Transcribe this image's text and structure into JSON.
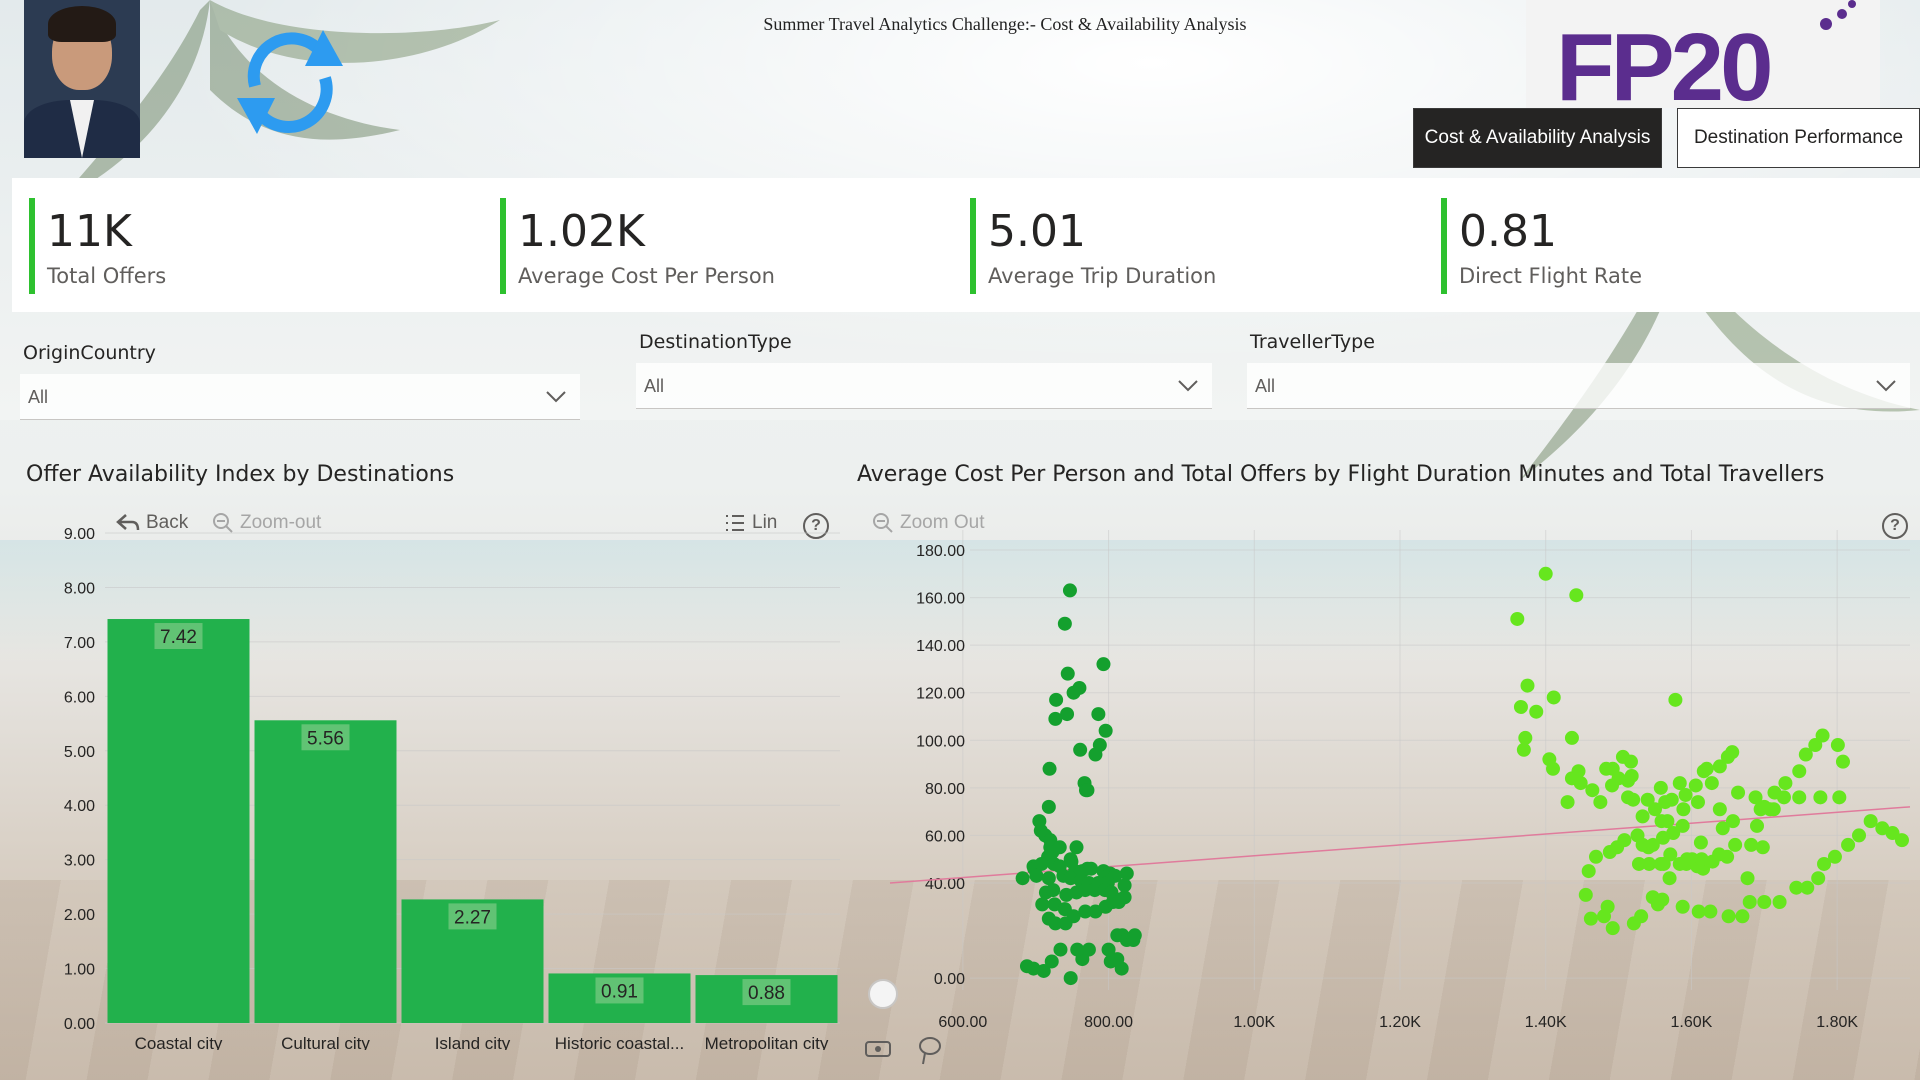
{
  "header": {
    "report_title": "Summer Travel Analytics Challenge:- Cost & Availability Analysis",
    "logo_text": "FP20",
    "tabs": [
      {
        "label": "Cost & Availability Analysis",
        "active": true
      },
      {
        "label": "Destination Performance",
        "active": false
      }
    ]
  },
  "kpis": [
    {
      "value": "11K",
      "label": "Total Offers"
    },
    {
      "value": "1.02K",
      "label": "Average Cost Per Person"
    },
    {
      "value": "5.01",
      "label": "Average Trip Duration"
    },
    {
      "value": "0.81",
      "label": "Direct Flight Rate"
    }
  ],
  "slicers": [
    {
      "title": "OriginCountry",
      "value": "All"
    },
    {
      "title": "DestinationType",
      "value": "All"
    },
    {
      "title": "TravellerType",
      "value": "All"
    }
  ],
  "bar_visual": {
    "title": "Offer Availability Index by Destinations",
    "toolbar": {
      "back": "Back",
      "zoom_out": "Zoom-out",
      "lin": "Lin"
    }
  },
  "scatter_visual": {
    "title": "Average Cost Per Person and Total Offers by Flight Duration Minutes and Total Travellers",
    "toolbar": {
      "zoom_out": "Zoom Out"
    }
  },
  "colors": {
    "accent": "#2ec12f",
    "bar": "#22b14c",
    "dark_point": "#14a02e",
    "light_point": "#66e61e",
    "trend": "#e07b9c",
    "tab_active_bg": "#252423"
  },
  "chart_data": [
    {
      "type": "bar",
      "categories": [
        "Coastal city",
        "Cultural city",
        "Island city",
        "Historic coastal...",
        "Metropolitan city"
      ],
      "values": [
        7.42,
        5.56,
        2.27,
        0.91,
        0.88
      ],
      "data_labels": [
        "7.42",
        "5.56",
        "2.27",
        "0.91",
        "0.88"
      ],
      "ylim": [
        0,
        9
      ],
      "y_ticks": [
        "0.00",
        "1.00",
        "2.00",
        "3.00",
        "4.00",
        "5.00",
        "6.00",
        "7.00",
        "8.00",
        "9.00"
      ],
      "grid": true
    },
    {
      "type": "scatter",
      "xlim": [
        500,
        1900
      ],
      "ylim": [
        -5,
        180
      ],
      "x_ticks": [
        {
          "v": 600,
          "label": "600.00"
        },
        {
          "v": 800,
          "label": "800.00"
        },
        {
          "v": 1000,
          "label": "1.00K"
        },
        {
          "v": 1200,
          "label": "1.20K"
        },
        {
          "v": 1400,
          "label": "1.40K"
        },
        {
          "v": 1600,
          "label": "1.60K"
        },
        {
          "v": 1800,
          "label": "1.80K"
        }
      ],
      "y_ticks": [
        {
          "v": 0,
          "label": "0.00"
        },
        {
          "v": 40,
          "label": "40.00"
        },
        {
          "v": 60,
          "label": "60.00"
        },
        {
          "v": 80,
          "label": "80.00"
        },
        {
          "v": 100,
          "label": "100.00"
        },
        {
          "v": 120,
          "label": "120.00"
        },
        {
          "v": 140,
          "label": "140.00"
        },
        {
          "v": 160,
          "label": "160.00"
        },
        {
          "v": 180,
          "label": "180.00"
        }
      ],
      "trendline": {
        "x": [
          500,
          1900
        ],
        "y": [
          40,
          72
        ]
      },
      "series": [
        {
          "color": "dark",
          "points": [
            [
              747,
              163
            ],
            [
              740,
              149
            ],
            [
              793,
              132
            ],
            [
              744,
              128
            ],
            [
              760,
              122
            ],
            [
              752,
              120
            ],
            [
              728,
              117
            ],
            [
              743,
              111
            ],
            [
              727,
              109
            ],
            [
              786,
              111
            ],
            [
              796,
              104
            ],
            [
              788,
              98
            ],
            [
              761,
              96
            ],
            [
              782,
              94
            ],
            [
              719,
              88
            ],
            [
              767,
              82
            ],
            [
              769,
              79
            ],
            [
              771,
              79
            ],
            [
              718,
              72
            ],
            [
              705,
              66
            ],
            [
              707,
              62
            ],
            [
              713,
              60
            ],
            [
              720,
              58
            ],
            [
              720,
              55
            ],
            [
              721,
              55
            ],
            [
              723,
              53
            ],
            [
              733,
              55
            ],
            [
              756,
              55
            ],
            [
              717,
              51
            ],
            [
              748,
              50
            ],
            [
              749,
              49
            ],
            [
              764,
              45
            ],
            [
              771,
              46
            ],
            [
              697,
              47
            ],
            [
              698,
              46
            ],
            [
              708,
              48
            ],
            [
              725,
              48
            ],
            [
              733,
              47
            ],
            [
              754,
              45
            ],
            [
              761,
              44
            ],
            [
              776,
              46
            ],
            [
              793,
              45
            ],
            [
              802,
              44
            ],
            [
              809,
              43
            ],
            [
              825,
              44
            ],
            [
              682,
              42
            ],
            [
              701,
              43
            ],
            [
              718,
              42
            ],
            [
              738,
              43
            ],
            [
              748,
              42
            ],
            [
              762,
              41
            ],
            [
              773,
              40
            ],
            [
              786,
              40
            ],
            [
              799,
              40
            ],
            [
              822,
              39
            ],
            [
              714,
              36
            ],
            [
              724,
              37
            ],
            [
              742,
              35
            ],
            [
              756,
              36
            ],
            [
              768,
              37
            ],
            [
              781,
              37
            ],
            [
              795,
              37
            ],
            [
              804,
              36
            ],
            [
              810,
              33
            ],
            [
              816,
              33
            ],
            [
              822,
              34
            ],
            [
              709,
              31
            ],
            [
              726,
              31
            ],
            [
              740,
              29
            ],
            [
              752,
              26
            ],
            [
              768,
              28
            ],
            [
              782,
              28
            ],
            [
              796,
              30
            ],
            [
              806,
              32
            ],
            [
              814,
              32
            ],
            [
              718,
              25
            ],
            [
              727,
              23
            ],
            [
              741,
              23
            ],
            [
              812,
              18
            ],
            [
              819,
              18
            ],
            [
              825,
              16
            ],
            [
              834,
              16
            ],
            [
              836,
              18
            ],
            [
              688,
              5
            ],
            [
              697,
              4
            ],
            [
              711,
              3
            ],
            [
              722,
              7
            ],
            [
              748,
              0
            ],
            [
              764,
              8
            ],
            [
              803,
              7
            ],
            [
              812,
              8
            ],
            [
              818,
              4
            ],
            [
              734,
              12
            ],
            [
              757,
              12
            ],
            [
              773,
              12
            ],
            [
              800,
              12
            ]
          ]
        },
        {
          "color": "light",
          "points": [
            [
              1400,
              170
            ],
            [
              1442,
              161
            ],
            [
              1361,
              151
            ],
            [
              1375,
              123
            ],
            [
              1366,
              114
            ],
            [
              1370,
              96
            ],
            [
              1387,
              112
            ],
            [
              1411,
              118
            ],
            [
              1372,
              101
            ],
            [
              1405,
              92
            ],
            [
              1410,
              88
            ],
            [
              1445,
              87
            ],
            [
              1578,
              117
            ],
            [
              1492,
              88
            ],
            [
              1513,
              83
            ],
            [
              1436,
              101
            ],
            [
              1518,
              85
            ],
            [
              1617,
              87
            ],
            [
              1513,
              76
            ],
            [
              1558,
              80
            ],
            [
              1573,
              75
            ],
            [
              1589,
              71
            ],
            [
              1609,
              74
            ],
            [
              1643,
              63
            ],
            [
              1698,
              55
            ],
            [
              1533,
              68
            ],
            [
              1559,
              66
            ],
            [
              1567,
              66
            ],
            [
              1639,
              71
            ],
            [
              1657,
              66
            ],
            [
              1613,
              57
            ],
            [
              1649,
              51
            ],
            [
              1677,
              42
            ],
            [
              1528,
              48
            ],
            [
              1542,
              48
            ],
            [
              1558,
              48
            ],
            [
              1562,
              48
            ],
            [
              1593,
              48
            ],
            [
              1608,
              47
            ],
            [
              1616,
              46
            ],
            [
              1570,
              42
            ],
            [
              1584,
              48
            ],
            [
              1601,
              50
            ],
            [
              1533,
              56
            ],
            [
              1541,
              55
            ],
            [
              1561,
              59
            ],
            [
              1575,
              61
            ],
            [
              1588,
              64
            ],
            [
              1430,
              74
            ],
            [
              1436,
              84
            ],
            [
              1448,
              82
            ],
            [
              1464,
              79
            ],
            [
              1475,
              74
            ],
            [
              1483,
              88
            ],
            [
              1491,
              81
            ],
            [
              1500,
              84
            ],
            [
              1506,
              93
            ],
            [
              1517,
              91
            ],
            [
              1520,
              75
            ],
            [
              1540,
              75
            ],
            [
              1550,
              71
            ],
            [
              1564,
              74
            ],
            [
              1584,
              82
            ],
            [
              1592,
              77
            ],
            [
              1606,
              81
            ],
            [
              1621,
              88
            ],
            [
              1628,
              82
            ],
            [
              1639,
              89
            ],
            [
              1650,
              93
            ],
            [
              1656,
              95
            ],
            [
              1664,
              78
            ],
            [
              1688,
              76
            ],
            [
              1695,
              71
            ],
            [
              1708,
              71
            ],
            [
              1714,
              78
            ],
            [
              1729,
              82
            ],
            [
              1748,
              87
            ],
            [
              1757,
              94
            ],
            [
              1770,
              98
            ],
            [
              1780,
              102
            ],
            [
              1801,
              98
            ],
            [
              1808,
              91
            ],
            [
              1803,
              76
            ],
            [
              1777,
              76
            ],
            [
              1748,
              76
            ],
            [
              1727,
              76
            ],
            [
              1713,
              71
            ],
            [
              1700,
              72
            ],
            [
              1690,
              64
            ],
            [
              1682,
              56
            ],
            [
              1660,
              56
            ],
            [
              1638,
              52
            ],
            [
              1629,
              49
            ],
            [
              1614,
              50
            ],
            [
              1594,
              50
            ],
            [
              1571,
              52
            ],
            [
              1547,
              56
            ],
            [
              1526,
              60
            ],
            [
              1508,
              58
            ],
            [
              1498,
              55
            ],
            [
              1488,
              53
            ],
            [
              1469,
              51
            ],
            [
              1459,
              45
            ],
            [
              1455,
              35
            ],
            [
              1462,
              25
            ],
            [
              1480,
              26
            ],
            [
              1485,
              30
            ],
            [
              1492,
              21
            ],
            [
              1521,
              23
            ],
            [
              1531,
              26
            ],
            [
              1547,
              34
            ],
            [
              1554,
              31
            ],
            [
              1560,
              33
            ],
            [
              1588,
              30
            ],
            [
              1610,
              28
            ],
            [
              1626,
              28
            ],
            [
              1651,
              26
            ],
            [
              1670,
              26
            ],
            [
              1680,
              32
            ],
            [
              1700,
              32
            ],
            [
              1721,
              32
            ],
            [
              1744,
              38
            ],
            [
              1759,
              38
            ],
            [
              1774,
              42
            ],
            [
              1782,
              48
            ],
            [
              1797,
              51
            ],
            [
              1815,
              56
            ],
            [
              1830,
              60
            ],
            [
              1846,
              66
            ],
            [
              1862,
              63
            ],
            [
              1876,
              61
            ],
            [
              1889,
              58
            ]
          ]
        }
      ]
    }
  ]
}
